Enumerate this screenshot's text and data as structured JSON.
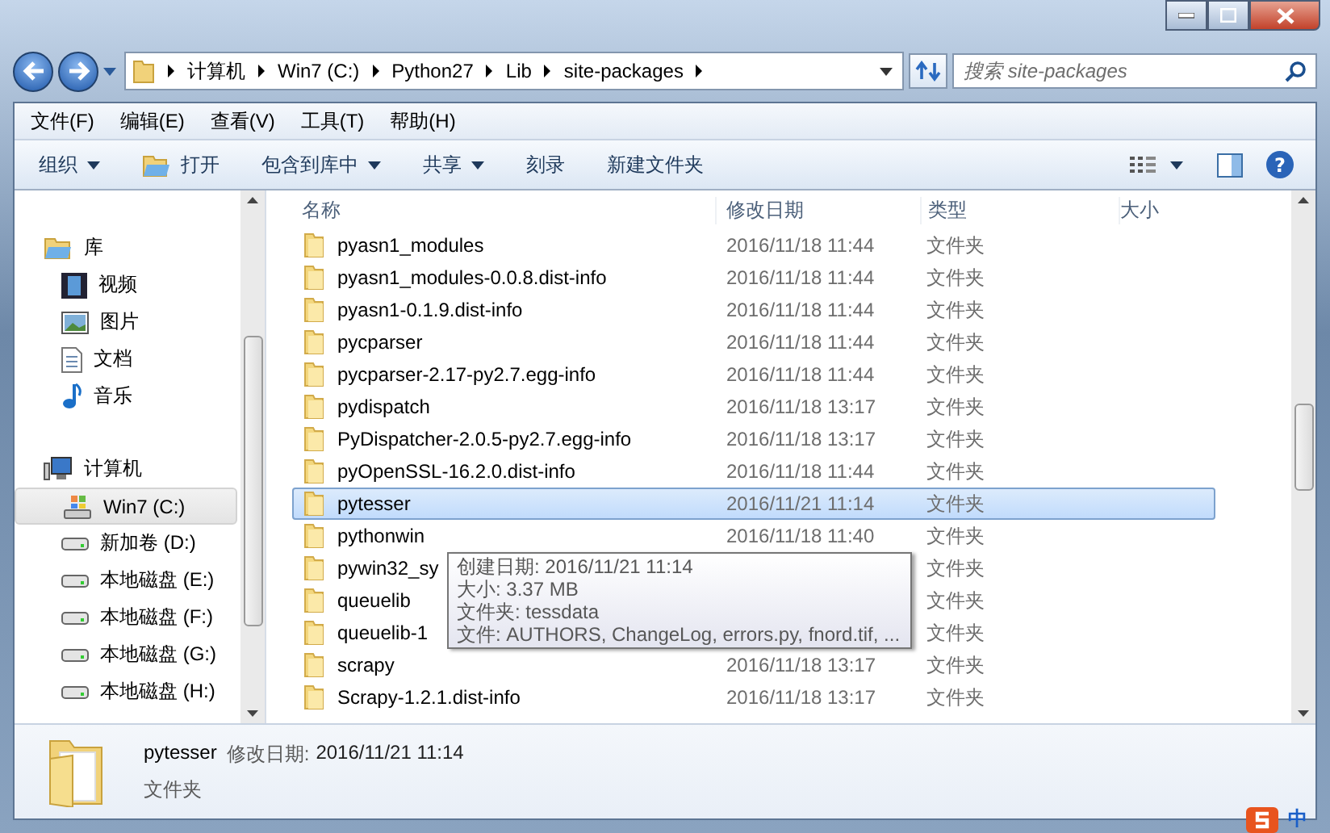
{
  "address_bar": {
    "crumbs": [
      "计算机",
      "Win7 (C:)",
      "Python27",
      "Lib",
      "site-packages"
    ]
  },
  "search": {
    "placeholder": "搜索 site-packages"
  },
  "menu": [
    "文件(F)",
    "编辑(E)",
    "查看(V)",
    "工具(T)",
    "帮助(H)"
  ],
  "toolbar": [
    {
      "label": "组织",
      "kind": "dropdown"
    },
    {
      "label": "打开",
      "kind": "open"
    },
    {
      "label": "包含到库中",
      "kind": "dropdown"
    },
    {
      "label": "共享",
      "kind": "dropdown"
    },
    {
      "label": "刻录",
      "kind": "plain"
    },
    {
      "label": "新建文件夹",
      "kind": "plain"
    }
  ],
  "sidebar": {
    "items": [
      {
        "label": "库",
        "kind": "library",
        "selected": false,
        "children": [
          {
            "label": "视频",
            "kind": "video",
            "selected": false
          },
          {
            "label": "图片",
            "kind": "picture",
            "selected": false
          },
          {
            "label": "文档",
            "kind": "document",
            "selected": false
          },
          {
            "label": "音乐",
            "kind": "music",
            "selected": false
          }
        ]
      },
      {
        "label": "计算机",
        "kind": "computer",
        "selected": false,
        "children": [
          {
            "label": "Win7 (C:)",
            "kind": "system-drive",
            "selected": true
          },
          {
            "label": "新加卷 (D:)",
            "kind": "drive",
            "selected": false
          },
          {
            "label": "本地磁盘 (E:)",
            "kind": "drive",
            "selected": false
          },
          {
            "label": "本地磁盘 (F:)",
            "kind": "drive",
            "selected": false
          },
          {
            "label": "本地磁盘 (G:)",
            "kind": "drive",
            "selected": false
          },
          {
            "label": "本地磁盘 (H:)",
            "kind": "drive",
            "selected": false
          }
        ]
      }
    ]
  },
  "table": {
    "columns": [
      "名称",
      "修改日期",
      "类型",
      "大小"
    ],
    "rows": [
      {
        "name": "pyasn1_modules",
        "date": "2016/11/18 11:44",
        "type": "文件夹",
        "selected": false
      },
      {
        "name": "pyasn1_modules-0.0.8.dist-info",
        "date": "2016/11/18 11:44",
        "type": "文件夹",
        "selected": false
      },
      {
        "name": "pyasn1-0.1.9.dist-info",
        "date": "2016/11/18 11:44",
        "type": "文件夹",
        "selected": false
      },
      {
        "name": "pycparser",
        "date": "2016/11/18 11:44",
        "type": "文件夹",
        "selected": false
      },
      {
        "name": "pycparser-2.17-py2.7.egg-info",
        "date": "2016/11/18 11:44",
        "type": "文件夹",
        "selected": false
      },
      {
        "name": "pydispatch",
        "date": "2016/11/18 13:17",
        "type": "文件夹",
        "selected": false
      },
      {
        "name": "PyDispatcher-2.0.5-py2.7.egg-info",
        "date": "2016/11/18 13:17",
        "type": "文件夹",
        "selected": false
      },
      {
        "name": "pyOpenSSL-16.2.0.dist-info",
        "date": "2016/11/18 11:44",
        "type": "文件夹",
        "selected": false
      },
      {
        "name": "pytesser",
        "date": "2016/11/21 11:14",
        "type": "文件夹",
        "selected": true
      },
      {
        "name": "pythonwin",
        "date": "2016/11/18 11:40",
        "type": "文件夹",
        "selected": false
      },
      {
        "name": "pywin32_sy",
        "type": "文件夹",
        "selected": false
      },
      {
        "name": "queuelib",
        "type": "文件夹",
        "selected": false
      },
      {
        "name": "queuelib-1",
        "type": "文件夹",
        "selected": false
      },
      {
        "name": "scrapy",
        "date": "2016/11/18 13:17",
        "type": "文件夹",
        "selected": false
      },
      {
        "name": "Scrapy-1.2.1.dist-info",
        "date": "2016/11/18 13:17",
        "type": "文件夹",
        "selected": false
      }
    ]
  },
  "tooltip": [
    "创建日期: 2016/11/21 11:14",
    "大小: 3.37 MB",
    "文件夹: tessdata",
    "文件: AUTHORS, ChangeLog, errors.py, fnord.tif, ..."
  ],
  "details": {
    "name": "pytesser",
    "date_label": "修改日期:",
    "date": "2016/11/21 11:14",
    "type": "文件夹"
  },
  "help_button": {
    "label": "?"
  },
  "ime": {
    "label": "中"
  }
}
